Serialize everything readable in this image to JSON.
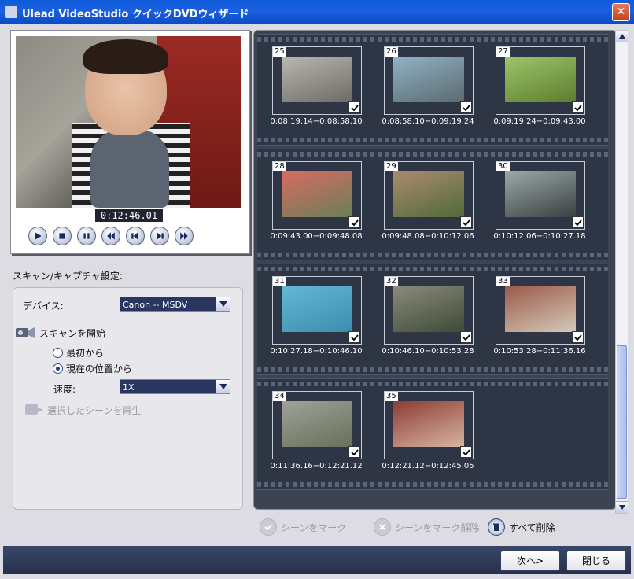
{
  "window": {
    "title": "Ulead VideoStudio クイックDVDウィザード",
    "close_glyph": "✕"
  },
  "preview": {
    "timecode": "0:12:46.01"
  },
  "controls": {
    "play": "play-icon",
    "stop": "stop-icon",
    "pause": "pause-icon",
    "rewind": "rewind-icon",
    "prev_frame": "prev-frame-icon",
    "next_frame": "next-frame-icon",
    "fast_forward": "fast-forward-icon"
  },
  "scan": {
    "section_label": "スキャン/キャプチャ設定:",
    "device_label": "デバイス:",
    "device_value": "Canon -- MSDV",
    "start_label": "スキャンを開始",
    "option_start": "最初から",
    "option_current": "現在の位置から",
    "selected_option": "current",
    "speed_label": "速度:",
    "speed_value": "1X",
    "play_selected": "選択したシーンを再生"
  },
  "scenes": [
    {
      "num": "25",
      "range": "0:08:19.14−0:08:58.10",
      "checked": true,
      "color1": "#b9b7b1",
      "color2": "#6d6b66"
    },
    {
      "num": "26",
      "range": "0:08:58.10−0:09:19.24",
      "checked": true,
      "color1": "#8fb2c6",
      "color2": "#5c6a6e"
    },
    {
      "num": "27",
      "range": "0:09:19.24−0:09:43.00",
      "checked": true,
      "color1": "#9ec46a",
      "color2": "#5c7d2f"
    },
    {
      "num": "28",
      "range": "0:09:43.00−0:09:48.08",
      "checked": true,
      "color1": "#d76b61",
      "color2": "#6a7f58"
    },
    {
      "num": "29",
      "range": "0:09:48.08−0:10:12.06",
      "checked": true,
      "color1": "#a98b6e",
      "color2": "#516a3a"
    },
    {
      "num": "30",
      "range": "0:10:12.06−0:10:27.18",
      "checked": true,
      "color1": "#9aa8a6",
      "color2": "#3a4140"
    },
    {
      "num": "31",
      "range": "0:10:27.18−0:10:46.10",
      "checked": true,
      "color1": "#62b8d6",
      "color2": "#3d8dae"
    },
    {
      "num": "32",
      "range": "0:10:46.10−0:10:53.28",
      "checked": true,
      "color1": "#8a8a7c",
      "color2": "#3f4a37"
    },
    {
      "num": "33",
      "range": "0:10:53.28−0:11:36.16",
      "checked": true,
      "color1": "#9a5a4a",
      "color2": "#d4c9b8"
    },
    {
      "num": "34",
      "range": "0:11:36.16−0:12:21.12",
      "checked": true,
      "color1": "#a0a298",
      "color2": "#66705a"
    },
    {
      "num": "35",
      "range": "0:12:21.12−0:12:45.05",
      "checked": true,
      "color1": "#8d3c34",
      "color2": "#d6b4a0"
    }
  ],
  "actions": {
    "mark": "シーンをマーク",
    "unmark": "シーンをマーク解除",
    "delete_all": "すべて削除"
  },
  "buttons": {
    "next": "次へ>",
    "close": "閉じる"
  }
}
